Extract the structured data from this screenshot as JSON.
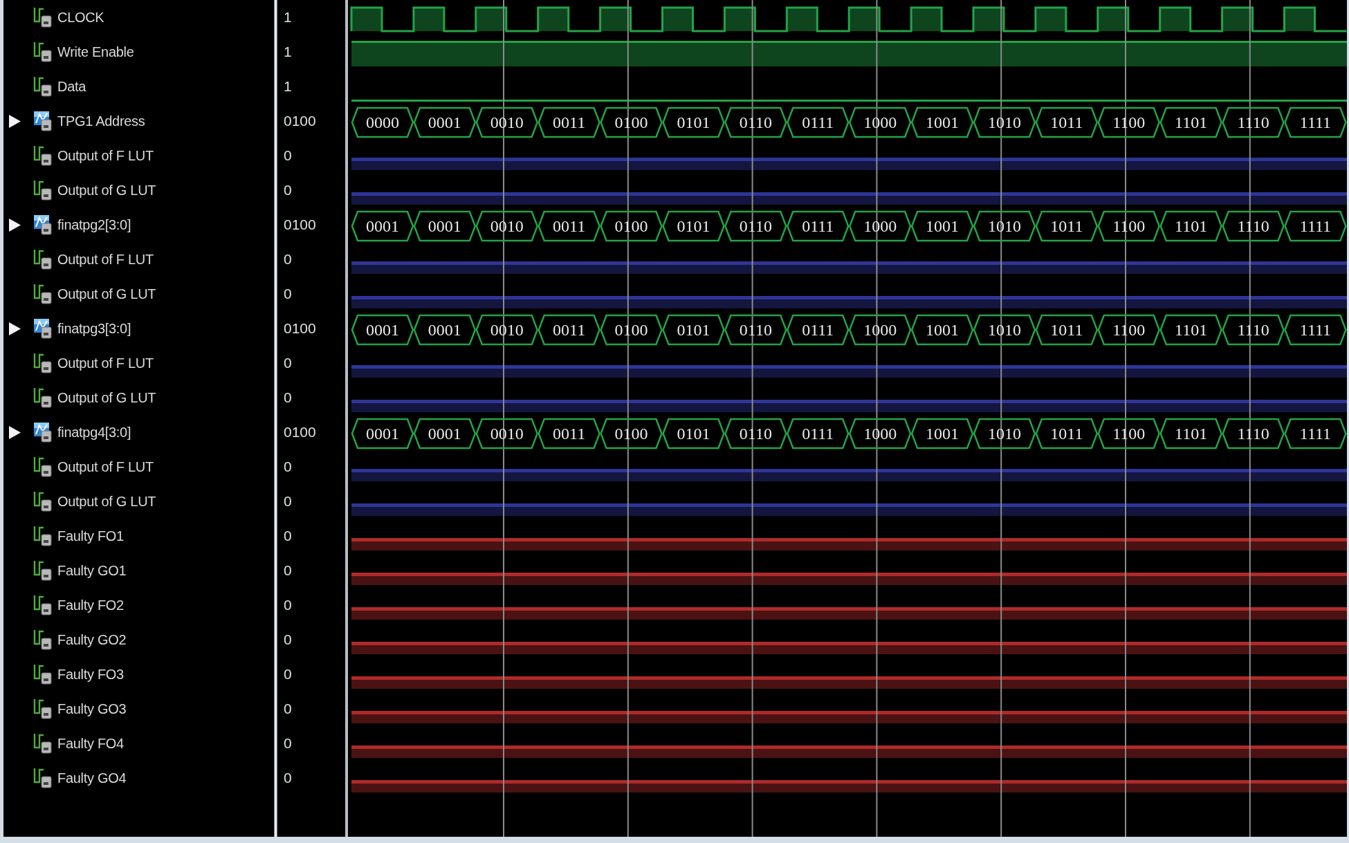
{
  "signals": [
    {
      "name": "CLOCK",
      "value": "1",
      "kind": "clock",
      "color": "#22a447"
    },
    {
      "name": "Write Enable",
      "value": "1",
      "kind": "high",
      "color": "#22a447"
    },
    {
      "name": "Data",
      "value": "1",
      "kind": "rail",
      "color": "#22a447"
    },
    {
      "name": "TPG1 Address",
      "value": "0100",
      "kind": "bus",
      "expanded": false,
      "color": "#22a447",
      "segments": [
        "0000",
        "0001",
        "0010",
        "0011",
        "0100",
        "0101",
        "0110",
        "0111",
        "1000",
        "1001",
        "1010",
        "1011",
        "1100",
        "1101",
        "1110",
        "1111"
      ]
    },
    {
      "name": "Output of F LUT",
      "value": "0",
      "kind": "low",
      "color": "#2f3598"
    },
    {
      "name": "Output of G LUT",
      "value": "0",
      "kind": "low",
      "color": "#2f3598"
    },
    {
      "name": "finatpg2[3:0]",
      "value": "0100",
      "kind": "bus",
      "expanded": false,
      "color": "#22a447",
      "segments": [
        "0001",
        "0001",
        "0010",
        "0011",
        "0100",
        "0101",
        "0110",
        "0111",
        "1000",
        "1001",
        "1010",
        "1011",
        "1100",
        "1101",
        "1110",
        "1111"
      ]
    },
    {
      "name": "Output of F LUT",
      "value": "0",
      "kind": "low",
      "color": "#2f3598"
    },
    {
      "name": "Output of G LUT",
      "value": "0",
      "kind": "low",
      "color": "#2f3598"
    },
    {
      "name": "finatpg3[3:0]",
      "value": "0100",
      "kind": "bus",
      "expanded": false,
      "color": "#22a447",
      "segments": [
        "0001",
        "0001",
        "0010",
        "0011",
        "0100",
        "0101",
        "0110",
        "0111",
        "1000",
        "1001",
        "1010",
        "1011",
        "1100",
        "1101",
        "1110",
        "1111"
      ]
    },
    {
      "name": "Output of F LUT",
      "value": "0",
      "kind": "low",
      "color": "#2f3598"
    },
    {
      "name": "Output of G LUT",
      "value": "0",
      "kind": "low",
      "color": "#2f3598"
    },
    {
      "name": "finatpg4[3:0]",
      "value": "0100",
      "kind": "bus",
      "expanded": false,
      "color": "#22a447",
      "segments": [
        "0001",
        "0001",
        "0010",
        "0011",
        "0100",
        "0101",
        "0110",
        "0111",
        "1000",
        "1001",
        "1010",
        "1011",
        "1100",
        "1101",
        "1110",
        "1111"
      ]
    },
    {
      "name": "Output of F LUT",
      "value": "0",
      "kind": "low",
      "color": "#2f3598"
    },
    {
      "name": "Output of G LUT",
      "value": "0",
      "kind": "low",
      "color": "#2f3598"
    },
    {
      "name": "Faulty FO1",
      "value": "0",
      "kind": "low",
      "color": "#b02a2a"
    },
    {
      "name": "Faulty GO1",
      "value": "0",
      "kind": "low",
      "color": "#b02a2a"
    },
    {
      "name": "Faulty FO2",
      "value": "0",
      "kind": "low",
      "color": "#b02a2a"
    },
    {
      "name": "Faulty GO2",
      "value": "0",
      "kind": "low",
      "color": "#b02a2a"
    },
    {
      "name": "Faulty FO3",
      "value": "0",
      "kind": "low",
      "color": "#b02a2a"
    },
    {
      "name": "Faulty GO3",
      "value": "0",
      "kind": "low",
      "color": "#b02a2a"
    },
    {
      "name": "Faulty FO4",
      "value": "0",
      "kind": "low",
      "color": "#b02a2a"
    },
    {
      "name": "Faulty GO4",
      "value": "0",
      "kind": "low",
      "color": "#b02a2a"
    }
  ]
}
